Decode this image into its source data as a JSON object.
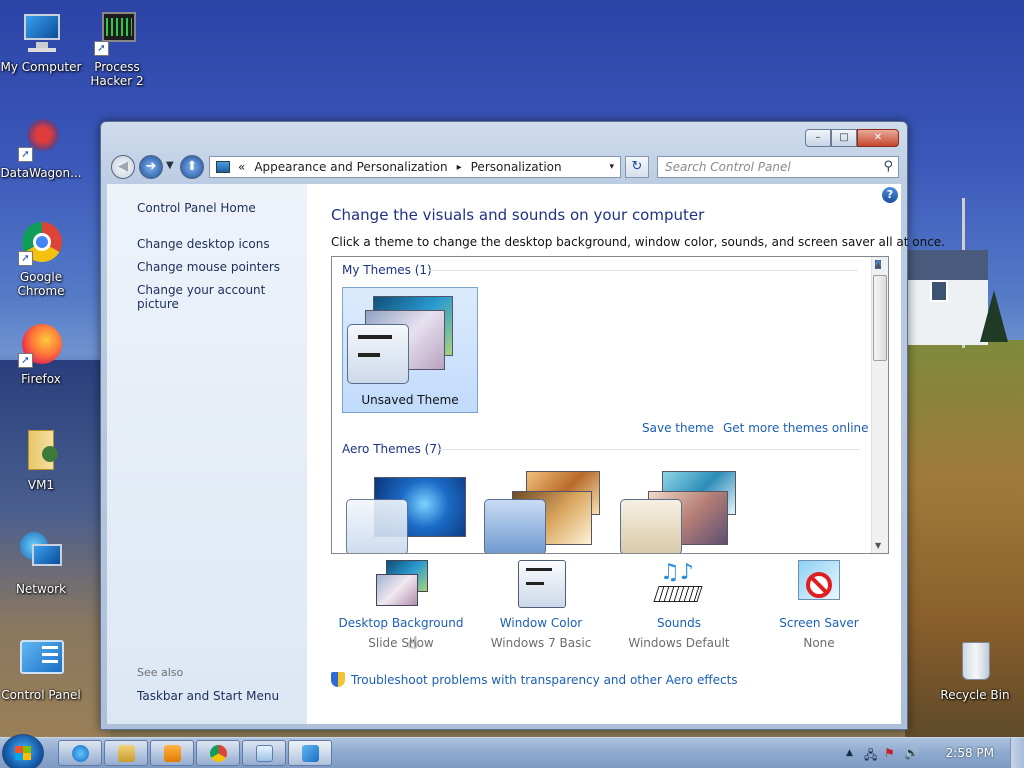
{
  "desktop": {
    "icons": [
      {
        "id": "my-computer",
        "label": "My Computer"
      },
      {
        "id": "process-hacker",
        "label": "Process Hacker 2"
      },
      {
        "id": "datawagon",
        "label": "DataWagon..."
      },
      {
        "id": "google-chrome",
        "label": "Google Chrome"
      },
      {
        "id": "firefox",
        "label": "Firefox"
      },
      {
        "id": "vm1",
        "label": "VM1"
      },
      {
        "id": "network",
        "label": "Network"
      },
      {
        "id": "control-panel",
        "label": "Control Panel"
      },
      {
        "id": "recycle-bin",
        "label": "Recycle Bin"
      }
    ]
  },
  "window": {
    "caption_buttons": {
      "minimize": "–",
      "maximize": "□",
      "close": "✕"
    },
    "address": {
      "prefix": "«",
      "crumb1": "Appearance and Personalization",
      "crumb2": "Personalization",
      "separator": "▸",
      "dropdown": "▾"
    },
    "search_placeholder": "Search Control Panel",
    "refresh": "↻",
    "help": "?"
  },
  "left_pane": {
    "home": "Control Panel Home",
    "links": [
      "Change desktop icons",
      "Change mouse pointers",
      "Change your account picture"
    ],
    "see_also": "See also",
    "see_also_links": [
      "Taskbar and Start Menu"
    ]
  },
  "main": {
    "title": "Change the visuals and sounds on your computer",
    "subtitle": "Click a theme to change the desktop background, window color, sounds, and screen saver all at once.",
    "my_themes_header": "My Themes (1)",
    "selected_theme": "Unsaved Theme",
    "save_theme": "Save theme",
    "get_more": "Get more themes online",
    "aero_header": "Aero Themes (7)",
    "settings": [
      {
        "label": "Desktop Background",
        "sub": "Slide Show"
      },
      {
        "label": "Window Color",
        "sub": "Windows 7 Basic"
      },
      {
        "label": "Sounds",
        "sub": "Windows Default"
      },
      {
        "label": "Screen Saver",
        "sub": "None"
      }
    ],
    "troubleshoot": "Troubleshoot problems with transparency and other Aero effects"
  },
  "taskbar": {
    "clock": "2:58 PM",
    "pinned": [
      "internet-explorer",
      "windows-explorer",
      "media-player",
      "chrome",
      "notepad",
      "control-panel"
    ]
  },
  "colors": {
    "link": "#1b5fb5",
    "title": "#1e3287",
    "selection": "#c1dbfc"
  }
}
